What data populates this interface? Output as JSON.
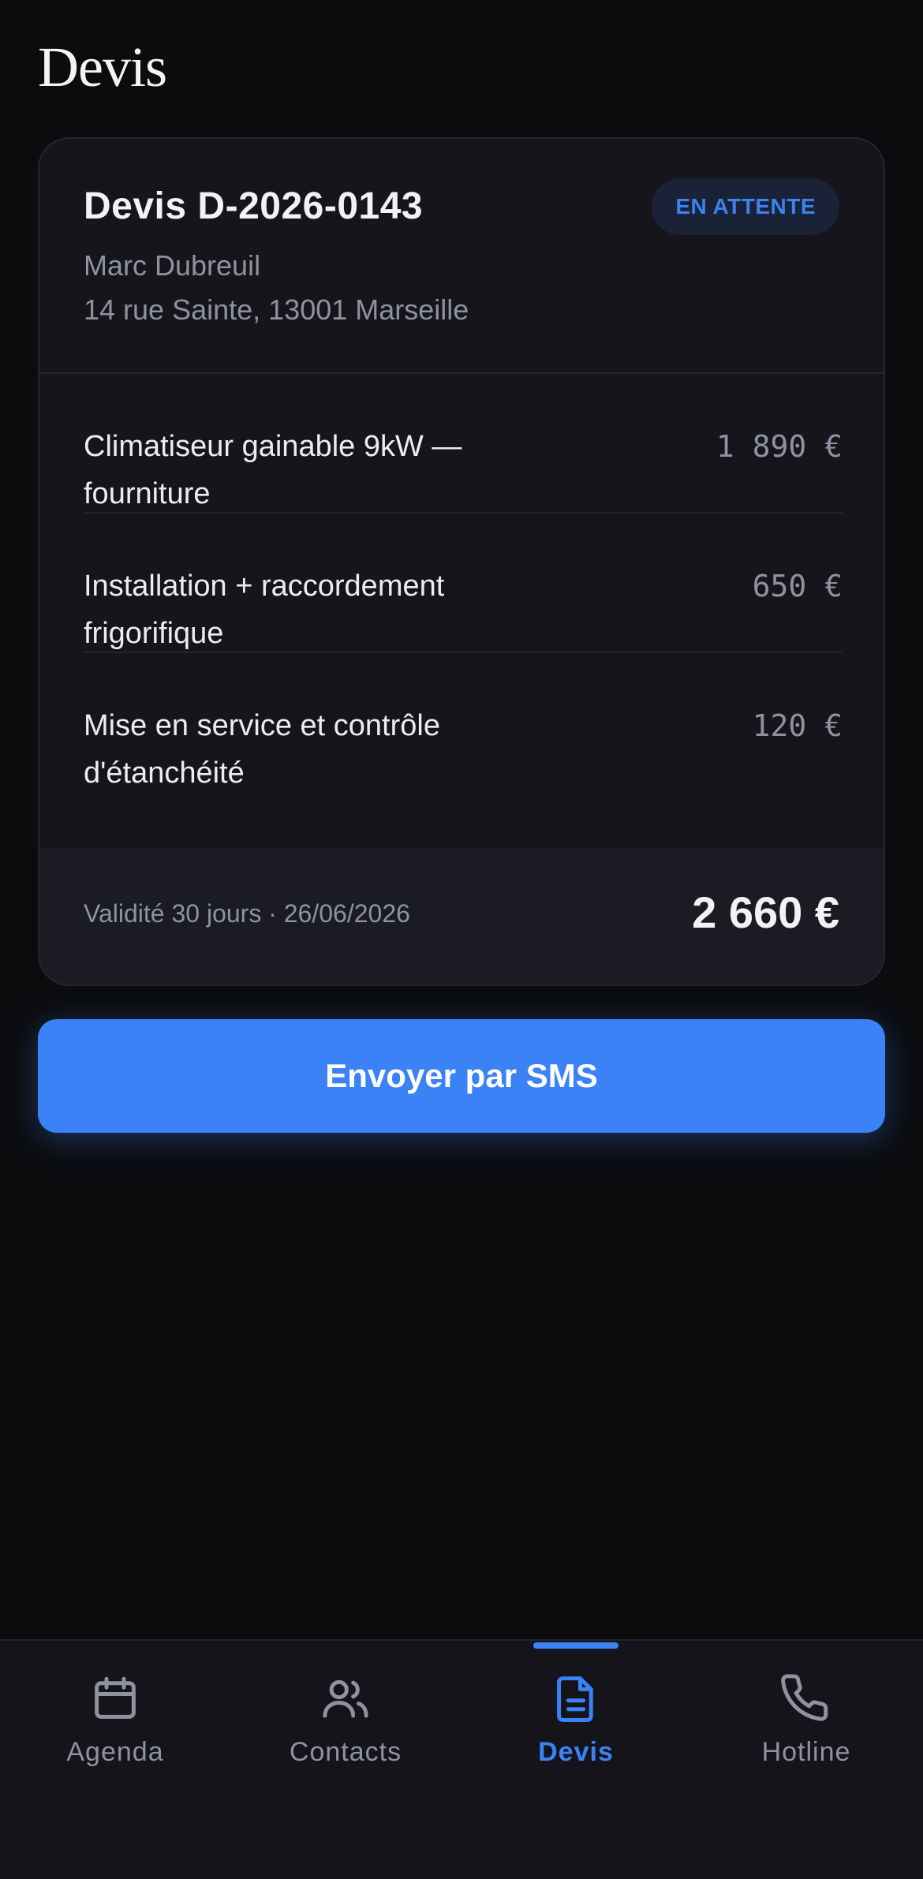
{
  "page": {
    "title": "Devis"
  },
  "quote": {
    "number": "Devis D-2026-0143",
    "status": "EN ATTENTE",
    "client_name": "Marc Dubreuil",
    "client_address": "14 rue Sainte, 13001 Marseille",
    "items": [
      {
        "label": "Climatiseur gainable 9kW — fourniture",
        "amount": "1 890 €"
      },
      {
        "label": "Installation + raccordement frigorifique",
        "amount": "650 €"
      },
      {
        "label": "Mise en service et contrôle d'étanchéité",
        "amount": "120 €"
      }
    ],
    "validity": "Validité 30 jours · 26/06/2026",
    "total": "2 660 €"
  },
  "actions": {
    "send_sms_label": "Envoyer par SMS"
  },
  "nav": {
    "items": [
      {
        "label": "Agenda",
        "icon": "calendar-icon"
      },
      {
        "label": "Contacts",
        "icon": "users-icon"
      },
      {
        "label": "Devis",
        "icon": "document-icon",
        "active": true
      },
      {
        "label": "Hotline",
        "icon": "phone-icon"
      }
    ]
  },
  "colors": {
    "background": "#0c0c0f",
    "card": "#15151b",
    "accent": "#3b82f6",
    "muted_text": "#8f92a0"
  }
}
